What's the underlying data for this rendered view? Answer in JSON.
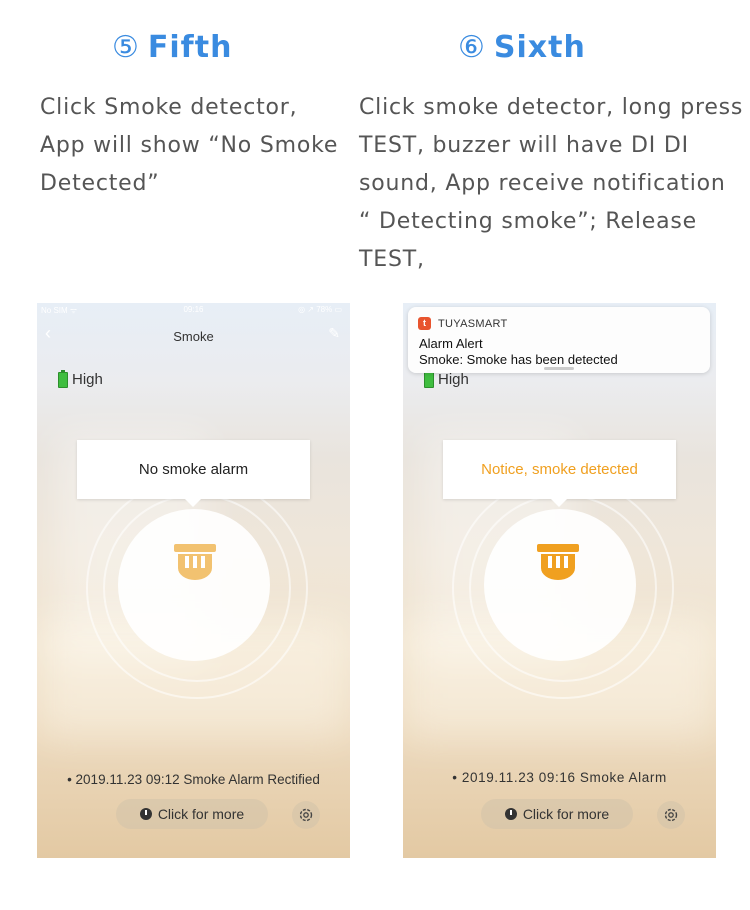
{
  "left": {
    "step_number": "⑤",
    "step_title": "Fifth",
    "description": [
      "Click Smoke detector,",
      "App will show “No Smoke",
      "Detected”"
    ],
    "phone": {
      "status_carrier": "No SIM ᯤ",
      "status_time": "09:16",
      "status_battery": "◎ ↗ 78% ▭",
      "nav_title": "Smoke",
      "battery_label": "High",
      "bubble_text": "No smoke alarm",
      "bubble_color": "#222222",
      "detector_color": "#f2c270",
      "log_entry": "• 2019.11.23 09:12 Smoke Alarm Rectified",
      "more_button": "Click for more"
    }
  },
  "right": {
    "step_number": "⑥",
    "step_title": "Sixth",
    "description": [
      "Click smoke detector, long press",
      "TEST, buzzer will have DI DI",
      "sound, App receive notification",
      "“ Detecting smoke”; Release",
      "TEST,"
    ],
    "phone": {
      "notification": {
        "app_icon_glyph": "t",
        "app_name": "TUYASMART",
        "title": "Alarm Alert",
        "body": "Smoke: Smoke has been detected"
      },
      "battery_label": "High",
      "bubble_text": "Notice, smoke detected",
      "bubble_color": "#f0a020",
      "detector_color": "#f0a020",
      "log_entry": "• 2019.11.23 09:16 Smoke Alarm",
      "more_button": "Click for more"
    }
  },
  "icons": {
    "battery": "battery-full-icon",
    "detector": "smoke-detector-icon",
    "clock": "clock-icon",
    "settings": "gear-icon",
    "back": "chevron-left-icon",
    "edit": "pencil-icon"
  },
  "colors": {
    "accent": "#3a8be0",
    "alert": "#f0a020",
    "battery_green": "#3fbd3f"
  }
}
